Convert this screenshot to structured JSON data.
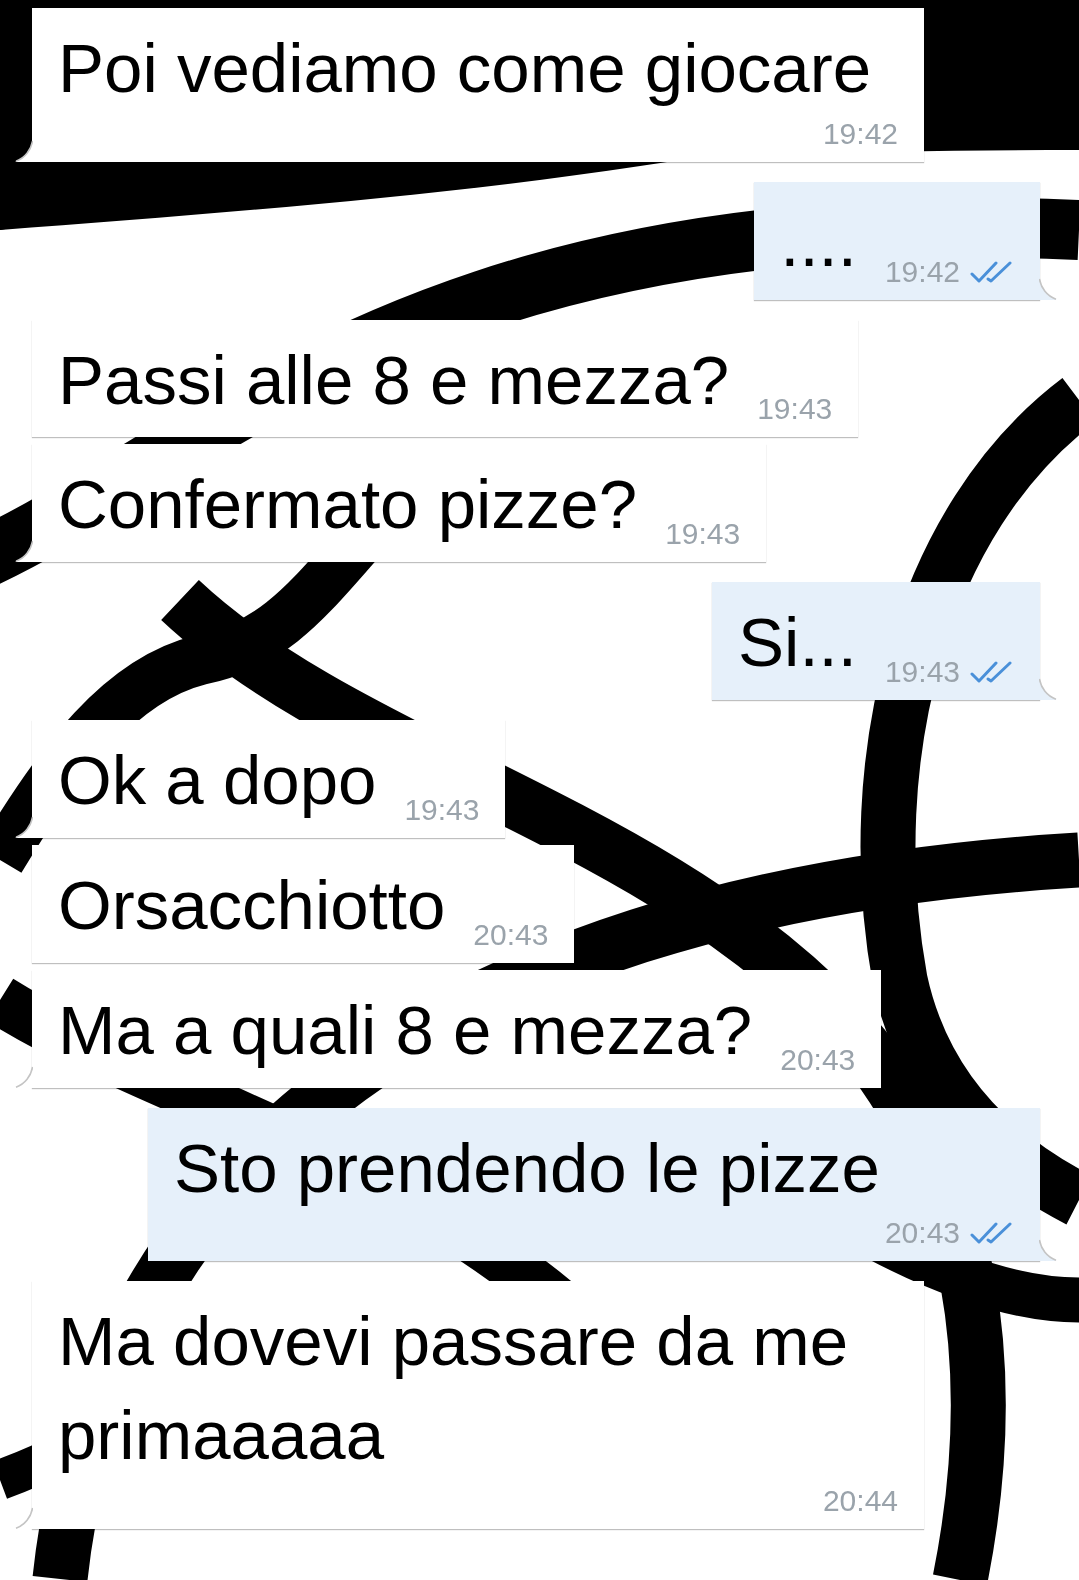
{
  "messages": [
    {
      "kind": "incoming",
      "text": "Poi vediamo come giocare",
      "time": "19:42",
      "tail": true
    },
    {
      "kind": "outgoing",
      "text": "....",
      "time": "19:42",
      "tail": true
    },
    {
      "kind": "incoming",
      "text": "Passi alle 8 e mezza?",
      "time": "19:43",
      "tail": false
    },
    {
      "kind": "incoming",
      "text": "Confermato pizze?",
      "time": "19:43",
      "tail": true
    },
    {
      "kind": "outgoing",
      "text": "Si...",
      "time": "19:43",
      "tail": true
    },
    {
      "kind": "incoming",
      "text": "Ok a dopo",
      "time": "19:43",
      "tail": true
    },
    {
      "kind": "incoming",
      "text": "Orsacchiotto",
      "time": "20:43",
      "tail": false
    },
    {
      "kind": "incoming",
      "text": "Ma a quali 8 e mezza?",
      "time": "20:43",
      "tail": true
    },
    {
      "kind": "outgoing",
      "text": "Sto prendendo le pizze",
      "time": "20:43",
      "tail": true
    },
    {
      "kind": "incoming",
      "text": "Ma dovevi passare da me primaaaaa",
      "time": "20:44",
      "tail": true
    }
  ]
}
